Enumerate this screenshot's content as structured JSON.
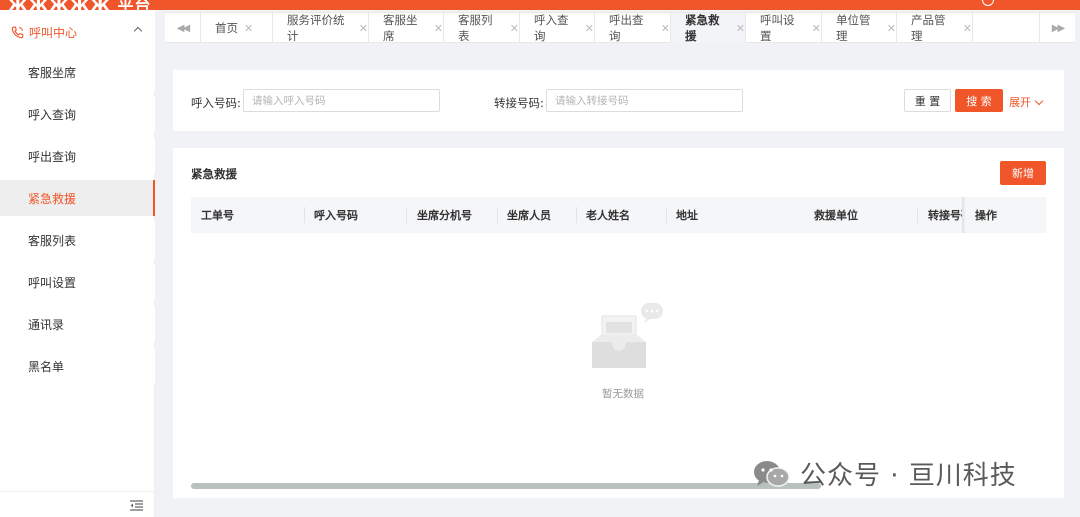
{
  "app": {
    "title": "ЖЖЖЖЖ 平台"
  },
  "sidebar": {
    "group_label": "呼叫中心",
    "items": [
      {
        "label": "客服坐席"
      },
      {
        "label": "呼入查询"
      },
      {
        "label": "呼出查询"
      },
      {
        "label": "紧急救援"
      },
      {
        "label": "客服列表"
      },
      {
        "label": "呼叫设置"
      },
      {
        "label": "通讯录"
      },
      {
        "label": "黑名单"
      }
    ],
    "active_item": "紧急救援"
  },
  "tabs": [
    {
      "label": "首页"
    },
    {
      "label": "服务评价统计"
    },
    {
      "label": "客服坐席"
    },
    {
      "label": "客服列表"
    },
    {
      "label": "呼入查询"
    },
    {
      "label": "呼出查询"
    },
    {
      "label": "紧急救援"
    },
    {
      "label": "呼叫设置"
    },
    {
      "label": "单位管理"
    },
    {
      "label": "产品管理"
    }
  ],
  "active_tab": "紧急救援",
  "search": {
    "incoming_label": "呼入号码:",
    "incoming_placeholder": "请输入呼入号码",
    "transfer_label": "转接号码:",
    "transfer_placeholder": "请输入转接号码",
    "reset_label": "重 置",
    "search_label": "搜 索",
    "expand_label": "展开"
  },
  "table": {
    "title": "紧急救援",
    "add_label": "新增",
    "columns": [
      "工单号",
      "呼入号码",
      "坐席分机号",
      "坐席人员",
      "老人姓名",
      "地址",
      "救援单位",
      "转接号码",
      "操作"
    ],
    "rows": [],
    "empty_text": "暂无数据"
  },
  "watermark": {
    "text": "公众号 · 亘川科技"
  },
  "colors": {
    "accent": "#f0562a",
    "active_bg": "#eeeeee",
    "header_bg": "#f5f6f8"
  },
  "icons": {
    "group": "phone-icon",
    "collapse": "chevron-up-icon",
    "fold": "menu-fold-icon",
    "tab_prev": "double-chevron-left-icon",
    "tab_next": "double-chevron-right-icon",
    "expand": "chevron-down-icon",
    "empty": "empty-inbox-icon",
    "watermark": "wechat-icon"
  }
}
